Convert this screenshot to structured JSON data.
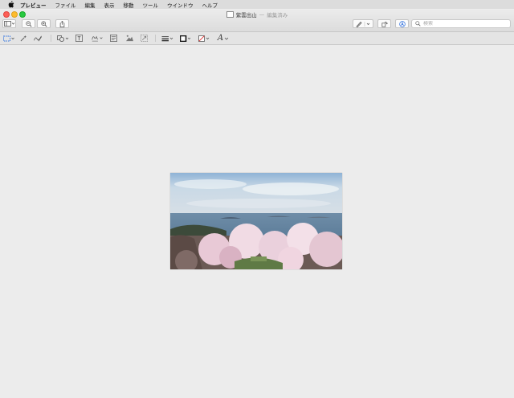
{
  "menubar": {
    "app_name": "プレビュー",
    "items": [
      "ファイル",
      "編集",
      "表示",
      "移動",
      "ツール",
      "ウインドウ",
      "ヘルプ"
    ]
  },
  "window": {
    "title": "紫雲出山",
    "title_separator": "—",
    "title_status": "編集済み"
  },
  "toolbar": {
    "search_placeholder": "検索",
    "icons": [
      "sidebar-icon",
      "zoom-out-icon",
      "zoom-in-icon",
      "share-icon",
      "pen-icon",
      "rotate-icon",
      "markup-icon",
      "search-icon"
    ]
  },
  "markup": {
    "tools": [
      "rectangular-selection",
      "instant-alpha",
      "sketch",
      "shapes",
      "text",
      "sign",
      "note",
      "adjust-color",
      "adjust-size",
      "shape-style",
      "border-color",
      "fill-color",
      "text-style"
    ],
    "text_style_glyph": "A"
  },
  "document": {
    "image_subject": "cherry blossoms over sea view"
  },
  "colors": {
    "close": "#fc5f57",
    "minimize": "#fdbc2e",
    "zoom": "#28c840",
    "canvas": "#ececec"
  }
}
